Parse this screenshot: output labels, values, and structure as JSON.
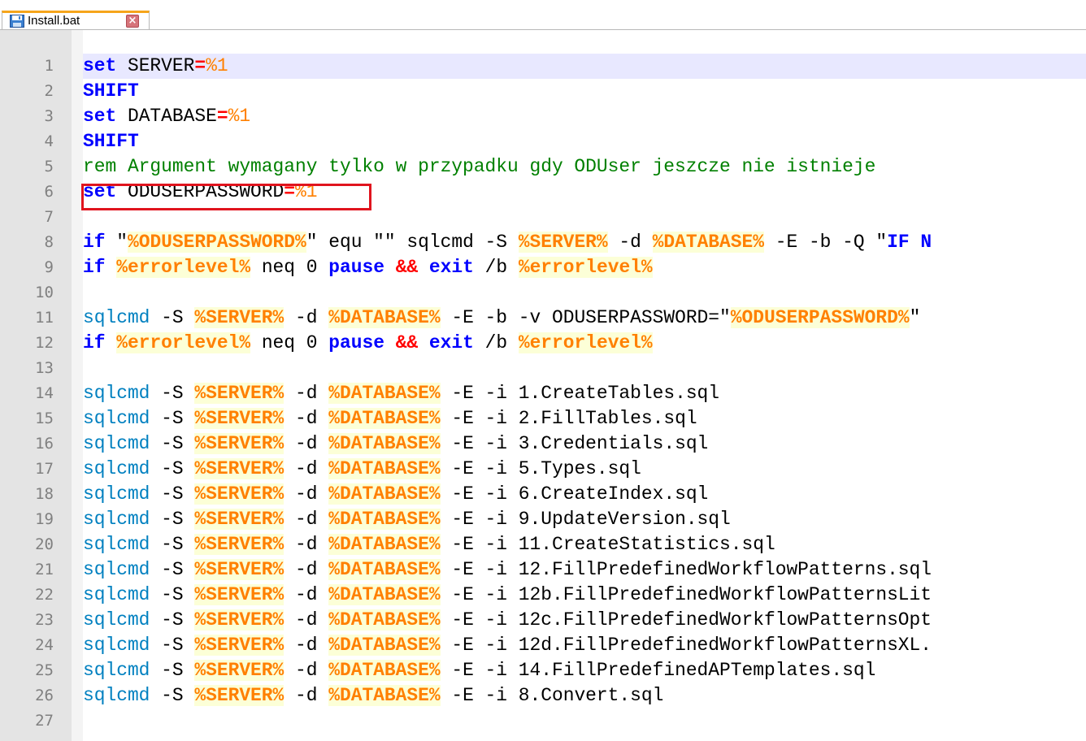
{
  "tab": {
    "filename": "Install.bat",
    "icon": "save-icon",
    "close_icon": "close-icon"
  },
  "editor": {
    "lines": [
      {
        "n": "1",
        "segs": [
          {
            "c": "kw",
            "t": "set"
          },
          {
            "c": "plain",
            "t": " SERVER"
          },
          {
            "c": "op",
            "t": "="
          },
          {
            "c": "num",
            "t": "%1"
          }
        ]
      },
      {
        "n": "2",
        "segs": [
          {
            "c": "kw",
            "t": "SHIFT"
          }
        ]
      },
      {
        "n": "3",
        "segs": [
          {
            "c": "kw",
            "t": "set"
          },
          {
            "c": "plain",
            "t": " DATABASE"
          },
          {
            "c": "op",
            "t": "="
          },
          {
            "c": "num",
            "t": "%1"
          }
        ]
      },
      {
        "n": "4",
        "segs": [
          {
            "c": "kw",
            "t": "SHIFT"
          }
        ]
      },
      {
        "n": "5",
        "segs": [
          {
            "c": "cmt",
            "t": "rem Argument wymagany tylko w przypadku gdy ODUser jeszcze nie istnieje"
          }
        ]
      },
      {
        "n": "6",
        "segs": [
          {
            "c": "kw",
            "t": "set"
          },
          {
            "c": "plain",
            "t": " ODUSERPASSWORD"
          },
          {
            "c": "op",
            "t": "="
          },
          {
            "c": "num",
            "t": "%1"
          }
        ]
      },
      {
        "n": "7",
        "segs": []
      },
      {
        "n": "8",
        "segs": [
          {
            "c": "kw",
            "t": "if"
          },
          {
            "c": "plain",
            "t": " \""
          },
          {
            "c": "var",
            "t": "%ODUSERPASSWORD%"
          },
          {
            "c": "plain",
            "t": "\" equ \"\" sqlcmd -S "
          },
          {
            "c": "var",
            "t": "%SERVER%"
          },
          {
            "c": "plain",
            "t": " -d "
          },
          {
            "c": "var",
            "t": "%DATABASE%"
          },
          {
            "c": "plain",
            "t": " -E -b -Q \""
          },
          {
            "c": "kw",
            "t": "IF N"
          }
        ]
      },
      {
        "n": "9",
        "segs": [
          {
            "c": "kw",
            "t": "if"
          },
          {
            "c": "plain",
            "t": " "
          },
          {
            "c": "var",
            "t": "%errorlevel%"
          },
          {
            "c": "plain",
            "t": " neq 0 "
          },
          {
            "c": "kw",
            "t": "pause"
          },
          {
            "c": "plain",
            "t": " "
          },
          {
            "c": "op",
            "t": "&&"
          },
          {
            "c": "plain",
            "t": " "
          },
          {
            "c": "kw",
            "t": "exit"
          },
          {
            "c": "plain",
            "t": " /b "
          },
          {
            "c": "var",
            "t": "%errorlevel%"
          }
        ]
      },
      {
        "n": "10",
        "segs": []
      },
      {
        "n": "11",
        "segs": [
          {
            "c": "ext",
            "t": "sqlcmd"
          },
          {
            "c": "plain",
            "t": " -S "
          },
          {
            "c": "var",
            "t": "%SERVER%"
          },
          {
            "c": "plain",
            "t": " -d "
          },
          {
            "c": "var",
            "t": "%DATABASE%"
          },
          {
            "c": "plain",
            "t": " -E -b -v ODUSERPASSWORD=\""
          },
          {
            "c": "var",
            "t": "%ODUSERPASSWORD%"
          },
          {
            "c": "plain",
            "t": "\""
          }
        ]
      },
      {
        "n": "12",
        "segs": [
          {
            "c": "kw",
            "t": "if"
          },
          {
            "c": "plain",
            "t": " "
          },
          {
            "c": "var",
            "t": "%errorlevel%"
          },
          {
            "c": "plain",
            "t": " neq 0 "
          },
          {
            "c": "kw",
            "t": "pause"
          },
          {
            "c": "plain",
            "t": " "
          },
          {
            "c": "op",
            "t": "&&"
          },
          {
            "c": "plain",
            "t": " "
          },
          {
            "c": "kw",
            "t": "exit"
          },
          {
            "c": "plain",
            "t": " /b "
          },
          {
            "c": "var",
            "t": "%errorlevel%"
          }
        ]
      },
      {
        "n": "13",
        "segs": []
      },
      {
        "n": "14",
        "segs": [
          {
            "c": "ext",
            "t": "sqlcmd"
          },
          {
            "c": "plain",
            "t": " -S "
          },
          {
            "c": "var",
            "t": "%SERVER%"
          },
          {
            "c": "plain",
            "t": " -d "
          },
          {
            "c": "var",
            "t": "%DATABASE%"
          },
          {
            "c": "plain",
            "t": " -E -i 1.CreateTables.sql"
          }
        ]
      },
      {
        "n": "15",
        "segs": [
          {
            "c": "ext",
            "t": "sqlcmd"
          },
          {
            "c": "plain",
            "t": " -S "
          },
          {
            "c": "var",
            "t": "%SERVER%"
          },
          {
            "c": "plain",
            "t": " -d "
          },
          {
            "c": "var",
            "t": "%DATABASE%"
          },
          {
            "c": "plain",
            "t": " -E -i 2.FillTables.sql"
          }
        ]
      },
      {
        "n": "16",
        "segs": [
          {
            "c": "ext",
            "t": "sqlcmd"
          },
          {
            "c": "plain",
            "t": " -S "
          },
          {
            "c": "var",
            "t": "%SERVER%"
          },
          {
            "c": "plain",
            "t": " -d "
          },
          {
            "c": "var",
            "t": "%DATABASE%"
          },
          {
            "c": "plain",
            "t": " -E -i 3.Credentials.sql"
          }
        ]
      },
      {
        "n": "17",
        "segs": [
          {
            "c": "ext",
            "t": "sqlcmd"
          },
          {
            "c": "plain",
            "t": " -S "
          },
          {
            "c": "var",
            "t": "%SERVER%"
          },
          {
            "c": "plain",
            "t": " -d "
          },
          {
            "c": "var",
            "t": "%DATABASE%"
          },
          {
            "c": "plain",
            "t": " -E -i 5.Types.sql"
          }
        ]
      },
      {
        "n": "18",
        "segs": [
          {
            "c": "ext",
            "t": "sqlcmd"
          },
          {
            "c": "plain",
            "t": " -S "
          },
          {
            "c": "var",
            "t": "%SERVER%"
          },
          {
            "c": "plain",
            "t": " -d "
          },
          {
            "c": "var",
            "t": "%DATABASE%"
          },
          {
            "c": "plain",
            "t": " -E -i 6.CreateIndex.sql"
          }
        ]
      },
      {
        "n": "19",
        "segs": [
          {
            "c": "ext",
            "t": "sqlcmd"
          },
          {
            "c": "plain",
            "t": " -S "
          },
          {
            "c": "var",
            "t": "%SERVER%"
          },
          {
            "c": "plain",
            "t": " -d "
          },
          {
            "c": "var",
            "t": "%DATABASE%"
          },
          {
            "c": "plain",
            "t": " -E -i 9.UpdateVersion.sql"
          }
        ]
      },
      {
        "n": "20",
        "segs": [
          {
            "c": "ext",
            "t": "sqlcmd"
          },
          {
            "c": "plain",
            "t": " -S "
          },
          {
            "c": "var",
            "t": "%SERVER%"
          },
          {
            "c": "plain",
            "t": " -d "
          },
          {
            "c": "var",
            "t": "%DATABASE%"
          },
          {
            "c": "plain",
            "t": " -E -i 11.CreateStatistics.sql"
          }
        ]
      },
      {
        "n": "21",
        "segs": [
          {
            "c": "ext",
            "t": "sqlcmd"
          },
          {
            "c": "plain",
            "t": " -S "
          },
          {
            "c": "var",
            "t": "%SERVER%"
          },
          {
            "c": "plain",
            "t": " -d "
          },
          {
            "c": "var",
            "t": "%DATABASE%"
          },
          {
            "c": "plain",
            "t": " -E -i 12.FillPredefinedWorkflowPatterns.sql"
          }
        ]
      },
      {
        "n": "22",
        "segs": [
          {
            "c": "ext",
            "t": "sqlcmd"
          },
          {
            "c": "plain",
            "t": " -S "
          },
          {
            "c": "var",
            "t": "%SERVER%"
          },
          {
            "c": "plain",
            "t": " -d "
          },
          {
            "c": "var",
            "t": "%DATABASE%"
          },
          {
            "c": "plain",
            "t": " -E -i 12b.FillPredefinedWorkflowPatternsLit"
          }
        ]
      },
      {
        "n": "23",
        "segs": [
          {
            "c": "ext",
            "t": "sqlcmd"
          },
          {
            "c": "plain",
            "t": " -S "
          },
          {
            "c": "var",
            "t": "%SERVER%"
          },
          {
            "c": "plain",
            "t": " -d "
          },
          {
            "c": "var",
            "t": "%DATABASE%"
          },
          {
            "c": "plain",
            "t": " -E -i 12c.FillPredefinedWorkflowPatternsOpt"
          }
        ]
      },
      {
        "n": "24",
        "segs": [
          {
            "c": "ext",
            "t": "sqlcmd"
          },
          {
            "c": "plain",
            "t": " -S "
          },
          {
            "c": "var",
            "t": "%SERVER%"
          },
          {
            "c": "plain",
            "t": " -d "
          },
          {
            "c": "var",
            "t": "%DATABASE%"
          },
          {
            "c": "plain",
            "t": " -E -i 12d.FillPredefinedWorkflowPatternsXL."
          }
        ]
      },
      {
        "n": "25",
        "segs": [
          {
            "c": "ext",
            "t": "sqlcmd"
          },
          {
            "c": "plain",
            "t": " -S "
          },
          {
            "c": "var",
            "t": "%SERVER%"
          },
          {
            "c": "plain",
            "t": " -d "
          },
          {
            "c": "var",
            "t": "%DATABASE%"
          },
          {
            "c": "plain",
            "t": " -E -i 14.FillPredefinedAPTemplates.sql"
          }
        ]
      },
      {
        "n": "26",
        "segs": [
          {
            "c": "ext",
            "t": "sqlcmd"
          },
          {
            "c": "plain",
            "t": " -S "
          },
          {
            "c": "var",
            "t": "%SERVER%"
          },
          {
            "c": "plain",
            "t": " -d "
          },
          {
            "c": "var",
            "t": "%DATABASE%"
          },
          {
            "c": "plain",
            "t": " -E -i 8.Convert.sql"
          }
        ]
      },
      {
        "n": "27",
        "segs": []
      }
    ],
    "current_line": 1,
    "highlighted_line": 6
  },
  "colors": {
    "keyword": "#0000ff",
    "operator": "#ff0000",
    "variable": "#ff8000",
    "comment": "#008000",
    "external_command": "#0080c0",
    "highlight_box": "#e0141e",
    "tab_accent": "#f6a51b"
  }
}
